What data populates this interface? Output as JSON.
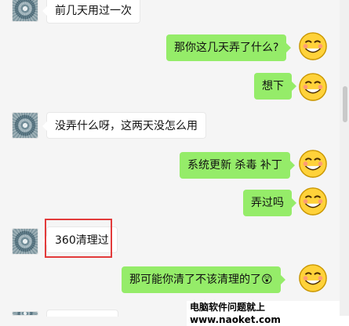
{
  "messages": [
    {
      "side": "in",
      "text": "前几天用过一次"
    },
    {
      "side": "out",
      "text": "那你这几天弄了什么?"
    },
    {
      "side": "out",
      "text": "想下"
    },
    {
      "side": "in",
      "text": "没弄什么呀，这两天没怎么用"
    },
    {
      "side": "out",
      "text": "系统更新 杀毒 补丁"
    },
    {
      "side": "out",
      "text": "弄过吗"
    },
    {
      "side": "in",
      "text": "360清理过"
    },
    {
      "side": "out",
      "text": "那可能你清了不该清理的了😲"
    }
  ],
  "watermark": "电脑软件问题就上www.naoket.com",
  "colors": {
    "outgoing_bubble": "#95ec69",
    "incoming_bubble": "#ffffff",
    "highlight": "#e23b3b",
    "background": "#f5f5f5"
  },
  "icons": {
    "contact_avatar": "contact-avatar",
    "self_avatar": "smiley-face-avatar"
  }
}
